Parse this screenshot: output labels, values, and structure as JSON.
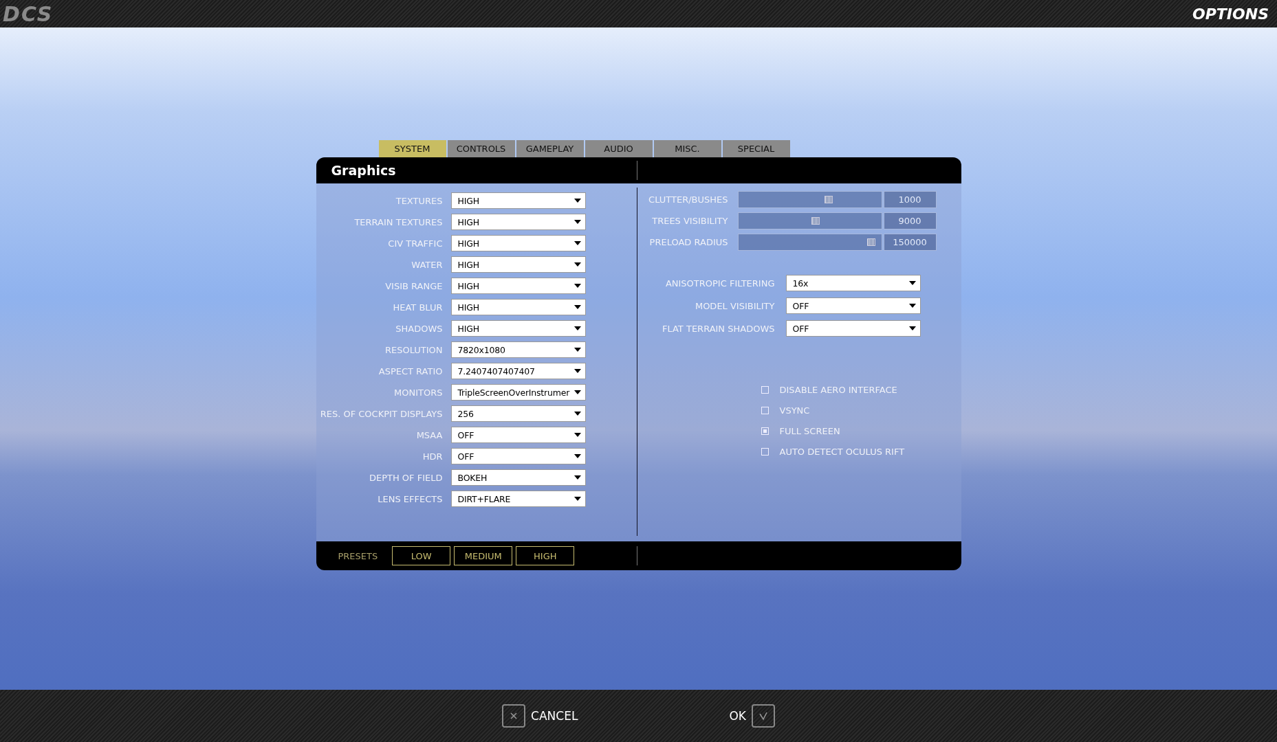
{
  "top_bar": {
    "logo": "DCS",
    "title": "OPTIONS"
  },
  "tabs": [
    {
      "label": "SYSTEM",
      "selected": true
    },
    {
      "label": "CONTROLS",
      "selected": false
    },
    {
      "label": "GAMEPLAY",
      "selected": false
    },
    {
      "label": "AUDIO",
      "selected": false
    },
    {
      "label": "MISC.",
      "selected": false
    },
    {
      "label": "SPECIAL",
      "selected": false
    }
  ],
  "panel": {
    "title": "Graphics"
  },
  "left_settings": [
    {
      "label": "TEXTURES",
      "value": "HIGH"
    },
    {
      "label": "TERRAIN TEXTURES",
      "value": "HIGH"
    },
    {
      "label": "CIV TRAFFIC",
      "value": "HIGH"
    },
    {
      "label": "WATER",
      "value": "HIGH"
    },
    {
      "label": "VISIB RANGE",
      "value": "HIGH"
    },
    {
      "label": "HEAT BLUR",
      "value": "HIGH"
    },
    {
      "label": "SHADOWS",
      "value": "HIGH"
    },
    {
      "label": "RESOLUTION",
      "value": "7820x1080"
    },
    {
      "label": "ASPECT RATIO",
      "value": "7.2407407407407"
    },
    {
      "label": "MONITORS",
      "value": "TripleScreenOverInstrumer"
    },
    {
      "label": "RES. OF COCKPIT DISPLAYS",
      "value": "256"
    },
    {
      "label": "MSAA",
      "value": "OFF"
    },
    {
      "label": "HDR",
      "value": "OFF"
    },
    {
      "label": "DEPTH OF FIELD",
      "value": "BOKEH"
    },
    {
      "label": "LENS EFFECTS",
      "value": "DIRT+FLARE"
    }
  ],
  "sliders": [
    {
      "label": "CLUTTER/BUSHES",
      "level": 0.63,
      "value": "1000"
    },
    {
      "label": "TREES VISIBILITY",
      "level": 0.54,
      "value": "9000"
    },
    {
      "label": "PRELOAD RADIUS",
      "level": 0.93,
      "value": "150000"
    }
  ],
  "right_settings": [
    {
      "label": "ANISOTROPIC FILTERING",
      "value": "16x"
    },
    {
      "label": "MODEL VISIBILITY",
      "value": "OFF"
    },
    {
      "label": "FLAT TERRAIN SHADOWS",
      "value": "OFF"
    }
  ],
  "checkboxes": [
    {
      "label": "DISABLE AERO INTERFACE",
      "checked": false
    },
    {
      "label": "VSYNC",
      "checked": false
    },
    {
      "label": "FULL SCREEN",
      "checked": true
    },
    {
      "label": "AUTO DETECT OCULUS RIFT",
      "checked": false
    }
  ],
  "presets": {
    "label": "PRESETS",
    "buttons": [
      "LOW",
      "MEDIUM",
      "HIGH"
    ]
  },
  "footer": {
    "cancel": "CANCEL",
    "ok": "OK"
  }
}
